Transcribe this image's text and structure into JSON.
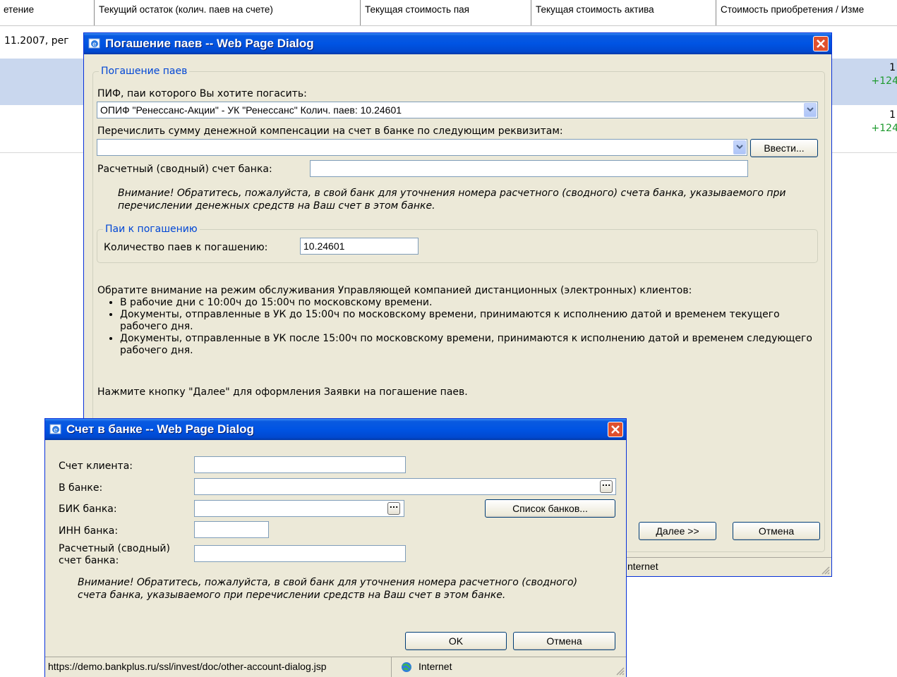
{
  "background": {
    "columns": [
      "етение",
      "Текущий остаток (колич. паев на счете)",
      "Текущая стоимость пая",
      "Текущая стоимость актива",
      "Стоимость приобретения / Изме"
    ],
    "row_text": "11.2007, рег",
    "row1_value": "1",
    "row1_change": "+124",
    "row2_value": "1",
    "row2_change": "+124"
  },
  "dialog_main": {
    "title": "Погашение паев -- Web Page Dialog",
    "section1_legend": "Погашение паев",
    "fund_label": "ПИФ, паи которого Вы хотите погасить:",
    "fund_selected": "ОПИФ \"Ренессанс-Акции\" - УК \"Ренессанс\"  Колич. паев: 10.24601",
    "transfer_label": "Перечислить сумму денежной компенсации на счет в банке по следующим реквизитам:",
    "transfer_selected": "",
    "enter_button": "Ввести...",
    "settlement_label": "Расчетный (сводный) счет банка:",
    "settlement_value": "",
    "warning": "Внимание! Обратитесь, пожалуйста, в свой банк для уточнения номера расчетного (сводного) счета банка, указываемого при перечислении денежных средств на Ваш счет в этом банке.",
    "section2_legend": "Паи к погашению",
    "quantity_label": "Количество паев к погашению:",
    "quantity_value": "10.24601",
    "info_heading": "Обратите внимание на режим обслуживания Управляющей компанией дистанционных (электронных) клиентов:",
    "info_items": [
      "В рабочие дни с 10:00ч до 15:00ч по московскому времени.",
      "Документы, отправленные в УК до 15:00ч по московскому времени, принимаются к исполнению датой и временем текущего рабочего дня.",
      "Документы, отправленные в УК после 15:00ч по московскому времени, принимаются к исполнению датой и временем следующего рабочего дня."
    ],
    "next_hint": "Нажмите кнопку \"Далее\" для оформления Заявки на погашение паев.",
    "next_button": "Далее >>",
    "cancel_button": "Отмена",
    "status_zone": "nternet"
  },
  "dialog_bank": {
    "title": "Счет в банке -- Web Page Dialog",
    "client_account_label": "Счет клиента:",
    "client_account_value": "",
    "bank_label": "В банке:",
    "bank_value": "",
    "bik_label": "БИК банка:",
    "bik_value": "",
    "bank_list_button": "Список банков...",
    "inn_label": "ИНН банка:",
    "inn_value": "",
    "settlement_label_line1": "Расчетный (сводный)",
    "settlement_label_line2": "счет банка:",
    "settlement_value": "",
    "warning": "Внимание! Обратитесь, пожалуйста, в свой банк для уточнения номера расчетного (сводного) счета банка, указываемого при перечислении средств на Ваш счет в этом банке.",
    "ok_button": "OK",
    "cancel_button": "Отмена",
    "status_url": "https://demo.bankplus.ru/ssl/invest/doc/other-account-dialog.jsp",
    "status_zone": "Internet"
  },
  "icons": [
    "ie-icon",
    "close-icon",
    "dropdown-arrow-icon",
    "ellipsis-icon",
    "globe-icon",
    "resize-grip-icon"
  ],
  "colors": {
    "titlebar": "#0054e3",
    "dialog_face": "#ece9d8",
    "legend": "#0046d5",
    "selected_row": "#c9d7ee",
    "positive": "#1e9a2e",
    "close": "#e0502d"
  }
}
